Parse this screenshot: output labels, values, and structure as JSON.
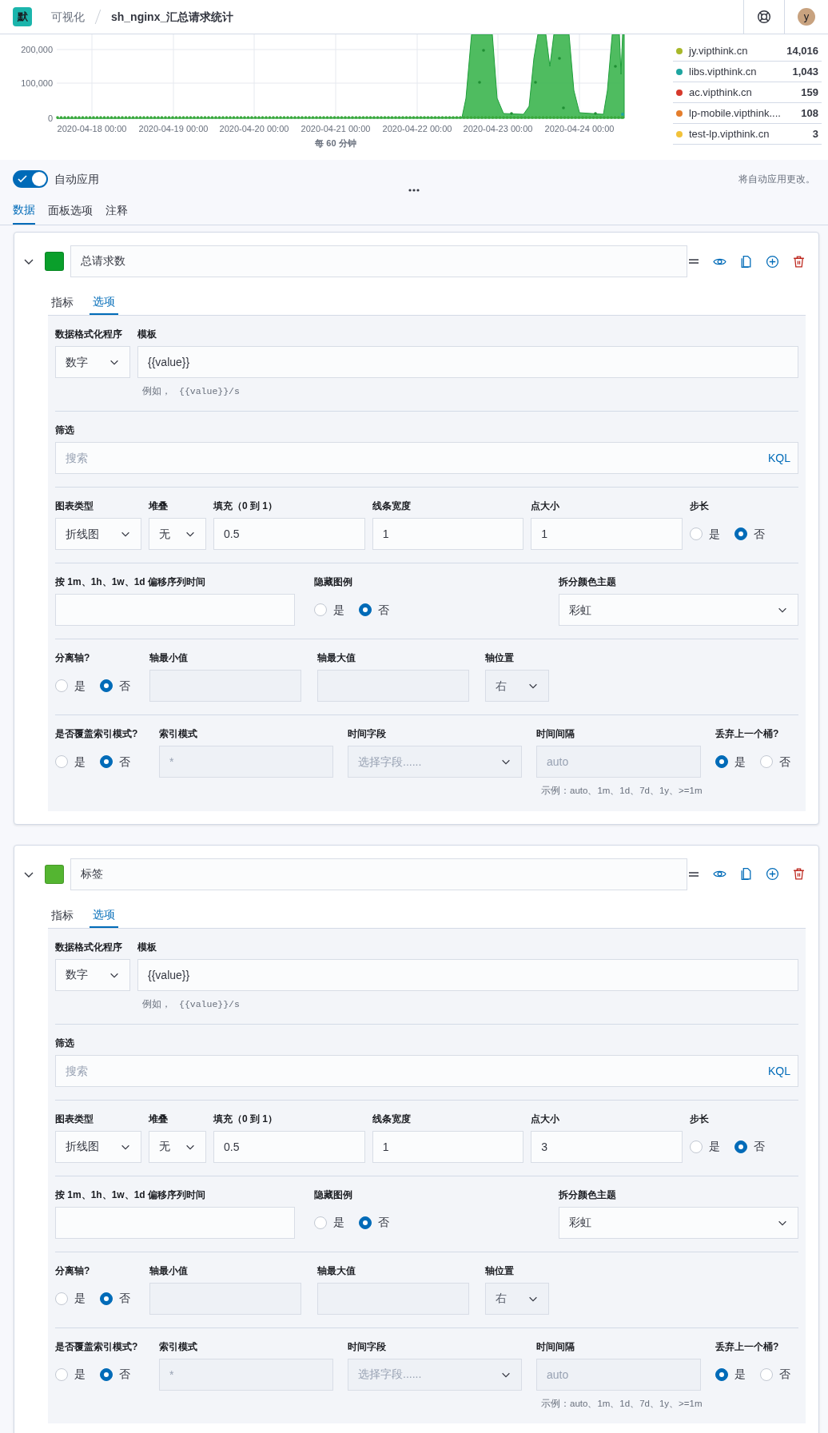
{
  "header": {
    "logo": "默",
    "breadcrumbs": [
      "可视化",
      "sh_nginx_汇总请求统计"
    ],
    "avatar": "y"
  },
  "chart": {
    "y_ticks": [
      "200,000",
      "100,000",
      "0"
    ],
    "x_labels": [
      "2020-04-18 00:00",
      "2020-04-19 00:00",
      "2020-04-20 00:00",
      "2020-04-21 00:00",
      "2020-04-22 00:00",
      "2020-04-23 00:00",
      "2020-04-24 00:00"
    ],
    "interval": "每 60 分钟",
    "legend": [
      {
        "name": "jy.vipthink.cn",
        "value": "14,016",
        "color": "#a8b82a"
      },
      {
        "name": "libs.vipthink.cn",
        "value": "1,043",
        "color": "#1ea5a0"
      },
      {
        "name": "ac.vipthink.cn",
        "value": "159",
        "color": "#d6392b"
      },
      {
        "name": "lp-mobile.vipthink....",
        "value": "108",
        "color": "#e47d2c"
      },
      {
        "name": "test-lp.vipthink.cn",
        "value": "3",
        "color": "#f2c23a"
      }
    ]
  },
  "auto_apply": {
    "label": "自动应用",
    "on": true,
    "note": "将自动应用更改。"
  },
  "tabs": [
    {
      "label": "数据",
      "selected": true
    },
    {
      "label": "面板选项",
      "selected": false
    },
    {
      "label": "注释",
      "selected": false
    }
  ],
  "series": [
    {
      "color": "#0a9f2b",
      "label": "总请求数",
      "expanded": true,
      "tabs": [
        {
          "label": "指标",
          "selected": false
        },
        {
          "label": "选项",
          "selected": true
        }
      ],
      "sections": [
        {
          "fields": [
            {
              "kind": "select",
              "label": "数据格式化程序",
              "value": "数字",
              "disabled": false
            },
            {
              "kind": "input",
              "label": "模板",
              "value": "{{value}}",
              "help": "例如，",
              "help_code": "{{value}}/s",
              "disabled": false
            }
          ]
        },
        {
          "fields": [
            {
              "kind": "search",
              "label": "筛选",
              "placeholder": "搜索",
              "language": "KQL"
            }
          ]
        },
        {
          "fields": [
            {
              "kind": "select",
              "label": "图表类型",
              "value": "折线图",
              "disabled": false
            },
            {
              "kind": "select",
              "label": "堆叠",
              "value": "无",
              "disabled": false
            },
            {
              "kind": "input",
              "label": "填充（0 到 1）",
              "value": "0.5",
              "disabled": false
            },
            {
              "kind": "input",
              "label": "线条宽度",
              "value": "1",
              "disabled": false
            },
            {
              "kind": "input",
              "label": "点大小",
              "value": "1",
              "disabled": false
            },
            {
              "kind": "radio",
              "label": "步长",
              "options": [
                {
                  "label": "是",
                  "selected": false
                },
                {
                  "label": "否",
                  "selected": true
                }
              ]
            }
          ]
        },
        {
          "fields": [
            {
              "kind": "input",
              "label": "按 1m、1h、1w、1d 偏移序列时间",
              "disabled": false
            },
            {
              "kind": "radio",
              "label": "隐藏图例",
              "options": [
                {
                  "label": "是",
                  "selected": false
                },
                {
                  "label": "否",
                  "selected": true
                }
              ]
            },
            {
              "kind": "select",
              "label": "拆分颜色主题",
              "value": "彩虹",
              "disabled": false
            }
          ]
        },
        {
          "fields": [
            {
              "kind": "radio",
              "label": "分离轴?",
              "options": [
                {
                  "label": "是",
                  "selected": false
                },
                {
                  "label": "否",
                  "selected": true
                }
              ]
            },
            {
              "kind": "input",
              "label": "轴最小值",
              "disabled": true
            },
            {
              "kind": "input",
              "label": "轴最大值",
              "disabled": true
            },
            {
              "kind": "select",
              "label": "轴位置",
              "value": "右",
              "disabled": true
            }
          ]
        },
        {
          "fields": [
            {
              "kind": "radio",
              "label": "是否覆盖索引模式?",
              "options": [
                {
                  "label": "是",
                  "selected": false
                },
                {
                  "label": "否",
                  "selected": true
                }
              ]
            },
            {
              "kind": "input",
              "label": "索引模式",
              "placeholder": "*",
              "disabled": true
            },
            {
              "kind": "select",
              "label": "时间字段",
              "placeholder": "选择字段......",
              "disabled": true
            },
            {
              "kind": "input",
              "label": "时间间隔",
              "placeholder": "auto",
              "help": "示例：auto、1m、1d、7d、1y、>=1m",
              "disabled": true
            },
            {
              "kind": "radio",
              "label": "丢弃上一个桶?",
              "options": [
                {
                  "label": "是",
                  "selected": true
                },
                {
                  "label": "否",
                  "selected": false
                }
              ]
            }
          ]
        }
      ]
    },
    {
      "color": "#54b531",
      "label": "标签",
      "expanded": true,
      "tabs": [
        {
          "label": "指标",
          "selected": false
        },
        {
          "label": "选项",
          "selected": true
        }
      ],
      "sections": [
        {
          "fields": [
            {
              "kind": "select",
              "label": "数据格式化程序",
              "value": "数字",
              "disabled": false
            },
            {
              "kind": "input",
              "label": "模板",
              "value": "{{value}}",
              "help": "例如，",
              "help_code": "{{value}}/s",
              "disabled": false
            }
          ]
        },
        {
          "fields": [
            {
              "kind": "search",
              "label": "筛选",
              "placeholder": "搜索",
              "language": "KQL"
            }
          ]
        },
        {
          "fields": [
            {
              "kind": "select",
              "label": "图表类型",
              "value": "折线图",
              "disabled": false
            },
            {
              "kind": "select",
              "label": "堆叠",
              "value": "无",
              "disabled": false
            },
            {
              "kind": "input",
              "label": "填充（0 到 1）",
              "value": "0.5",
              "disabled": false
            },
            {
              "kind": "input",
              "label": "线条宽度",
              "value": "1",
              "disabled": false
            },
            {
              "kind": "input",
              "label": "点大小",
              "value": "3",
              "disabled": false
            },
            {
              "kind": "radio",
              "label": "步长",
              "options": [
                {
                  "label": "是",
                  "selected": false
                },
                {
                  "label": "否",
                  "selected": true
                }
              ]
            }
          ]
        },
        {
          "fields": [
            {
              "kind": "input",
              "label": "按 1m、1h、1w、1d 偏移序列时间",
              "disabled": false
            },
            {
              "kind": "radio",
              "label": "隐藏图例",
              "options": [
                {
                  "label": "是",
                  "selected": false
                },
                {
                  "label": "否",
                  "selected": true
                }
              ]
            },
            {
              "kind": "select",
              "label": "拆分颜色主题",
              "value": "彩虹",
              "disabled": false
            }
          ]
        },
        {
          "fields": [
            {
              "kind": "radio",
              "label": "分离轴?",
              "options": [
                {
                  "label": "是",
                  "selected": false
                },
                {
                  "label": "否",
                  "selected": true
                }
              ]
            },
            {
              "kind": "input",
              "label": "轴最小值",
              "disabled": true
            },
            {
              "kind": "input",
              "label": "轴最大值",
              "disabled": true
            },
            {
              "kind": "select",
              "label": "轴位置",
              "value": "右",
              "disabled": true
            }
          ]
        },
        {
          "fields": [
            {
              "kind": "radio",
              "label": "是否覆盖索引模式?",
              "options": [
                {
                  "label": "是",
                  "selected": false
                },
                {
                  "label": "否",
                  "selected": true
                }
              ]
            },
            {
              "kind": "input",
              "label": "索引模式",
              "placeholder": "*",
              "disabled": true
            },
            {
              "kind": "select",
              "label": "时间字段",
              "placeholder": "选择字段......",
              "disabled": true
            },
            {
              "kind": "input",
              "label": "时间间隔",
              "placeholder": "auto",
              "help": "示例：auto、1m、1d、7d、1y、>=1m",
              "disabled": true
            },
            {
              "kind": "radio",
              "label": "丢弃上一个桶?",
              "options": [
                {
                  "label": "是",
                  "selected": true
                },
                {
                  "label": "否",
                  "selected": false
                }
              ]
            }
          ]
        }
      ]
    }
  ]
}
